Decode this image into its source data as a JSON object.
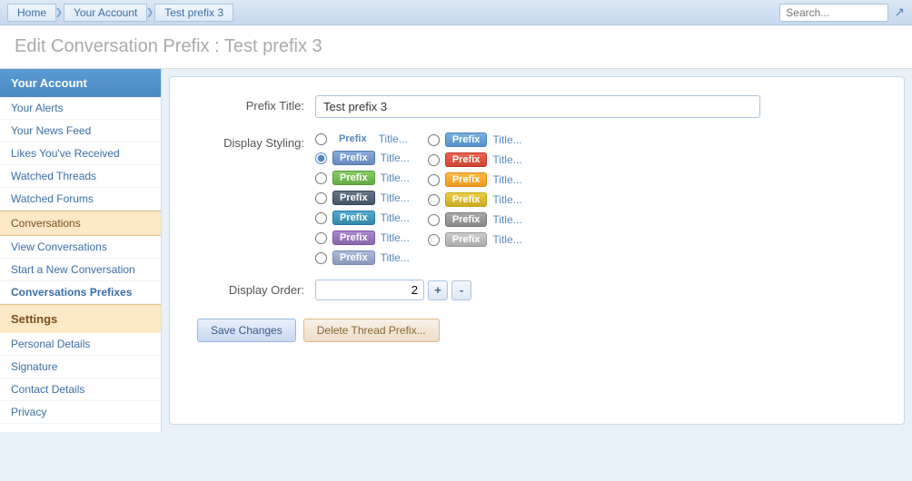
{
  "topbar": {
    "breadcrumb": [
      "Home",
      "Your Account",
      "Test prefix 3"
    ],
    "search_placeholder": "Search..."
  },
  "page_title": "Edit Conversation Prefix : ",
  "page_title_suffix": "Test prefix 3",
  "sidebar": {
    "account_header": "Your Account",
    "account_items": [
      {
        "label": "Your Alerts",
        "active": false
      },
      {
        "label": "Your News Feed",
        "active": false
      },
      {
        "label": "Likes You've Received",
        "active": false
      },
      {
        "label": "Watched Threads",
        "active": false
      },
      {
        "label": "Watched Forums",
        "active": false
      }
    ],
    "conversations_header": "Conversations",
    "conversations_items": [
      {
        "label": "View Conversations",
        "active": false
      },
      {
        "label": "Start a New Conversation",
        "active": false
      },
      {
        "label": "Conversations Prefixes",
        "active": true,
        "bold": true
      }
    ],
    "settings_header": "Settings",
    "settings_items": [
      {
        "label": "Personal Details",
        "active": false
      },
      {
        "label": "Signature",
        "active": false
      },
      {
        "label": "Contact Details",
        "active": false
      },
      {
        "label": "Privacy",
        "active": false
      }
    ]
  },
  "form": {
    "prefix_title_label": "Prefix Title:",
    "prefix_title_value": "Test prefix 3",
    "display_styling_label": "Display Styling:",
    "display_order_label": "Display Order:",
    "display_order_value": "2",
    "plus_label": "+",
    "minus_label": "-"
  },
  "styling_rows_left": [
    {
      "selected": false,
      "badge_class": "prefix-plain",
      "badge_text": "Prefix",
      "title": "Title..."
    },
    {
      "selected": true,
      "badge_class": "prefix-blue2",
      "badge_text": "Prefix",
      "title": "Title..."
    },
    {
      "selected": false,
      "badge_class": "prefix-green",
      "badge_text": "Prefix",
      "title": "Title..."
    },
    {
      "selected": false,
      "badge_class": "prefix-dark",
      "badge_text": "Prefix",
      "title": "Title..."
    },
    {
      "selected": false,
      "badge_class": "prefix-teal",
      "badge_text": "Prefix",
      "title": "Title..."
    },
    {
      "selected": false,
      "badge_class": "prefix-purple",
      "badge_text": "Prefix",
      "title": "Title..."
    },
    {
      "selected": false,
      "badge_class": "prefix-lavender",
      "badge_text": "Prefix",
      "title": "Title..."
    }
  ],
  "styling_rows_right": [
    {
      "selected": false,
      "badge_class": "prefix-blue",
      "badge_text": "Prefix",
      "title": "Title..."
    },
    {
      "selected": false,
      "badge_class": "prefix-red",
      "badge_text": "Prefix",
      "title": "Title..."
    },
    {
      "selected": false,
      "badge_class": "prefix-orange",
      "badge_text": "Prefix",
      "title": "Title..."
    },
    {
      "selected": false,
      "badge_class": "prefix-yellow",
      "badge_text": "Prefix",
      "title": "Title..."
    },
    {
      "selected": false,
      "badge_class": "prefix-gray",
      "badge_text": "Prefix",
      "title": "Title..."
    },
    {
      "selected": false,
      "badge_class": "prefix-lightgray",
      "badge_text": "Prefix",
      "title": "Title..."
    }
  ],
  "buttons": {
    "save": "Save Changes",
    "delete": "Delete Thread Prefix..."
  }
}
